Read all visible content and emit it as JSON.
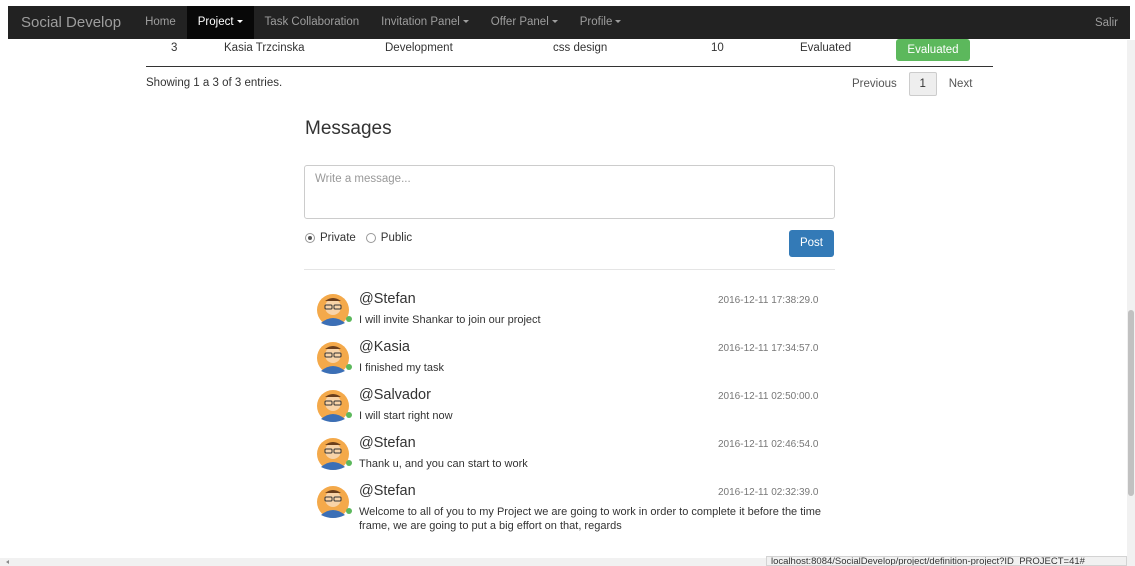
{
  "navbar": {
    "brand": "Social Develop",
    "items": [
      {
        "label": "Home",
        "dropdown": false,
        "active": false
      },
      {
        "label": "Project",
        "dropdown": true,
        "active": true
      },
      {
        "label": "Task Collaboration",
        "dropdown": false,
        "active": false
      },
      {
        "label": "Invitation Panel",
        "dropdown": true,
        "active": false
      },
      {
        "label": "Offer Panel",
        "dropdown": true,
        "active": false
      },
      {
        "label": "Profile",
        "dropdown": true,
        "active": false
      }
    ],
    "right_link": "Salir"
  },
  "table": {
    "last_row": {
      "id": "3",
      "name": "Kasia Trzcinska",
      "area": "Development",
      "task": "css design",
      "score": "10",
      "status": "Evaluated",
      "action": "Evaluated"
    },
    "info": "Showing 1 a 3 of 3 entries.",
    "pager": {
      "previous": "Previous",
      "current": "1",
      "next": "Next"
    }
  },
  "messages": {
    "title": "Messages",
    "placeholder": "Write a message...",
    "visibility": {
      "private": "Private",
      "public": "Public",
      "selected": "Private"
    },
    "post_label": "Post",
    "items": [
      {
        "user": "@Stefan",
        "time": "2016-12-11 17:38:29.0",
        "text": "I will invite Shankar to join our project"
      },
      {
        "user": "@Kasia",
        "time": "2016-12-11 17:34:57.0",
        "text": "I finished my task"
      },
      {
        "user": "@Salvador",
        "time": "2016-12-11 02:50:00.0",
        "text": "I will start right now"
      },
      {
        "user": "@Stefan",
        "time": "2016-12-11 02:46:54.0",
        "text": "Thank u, and you can start to work"
      },
      {
        "user": "@Stefan",
        "time": "2016-12-11 02:32:39.0",
        "text": "Welcome to all of you to my Project we are going to work in order to complete it before the time frame, we are going to put a big effort on that, regards"
      }
    ]
  },
  "status_url": "localhost:8084/SocialDevelop/project/definition-project?ID_PROJECT=41#",
  "colors": {
    "navbar": "#222222",
    "success": "#5cb85c",
    "primary": "#337ab7",
    "online": "#5cb85c"
  }
}
